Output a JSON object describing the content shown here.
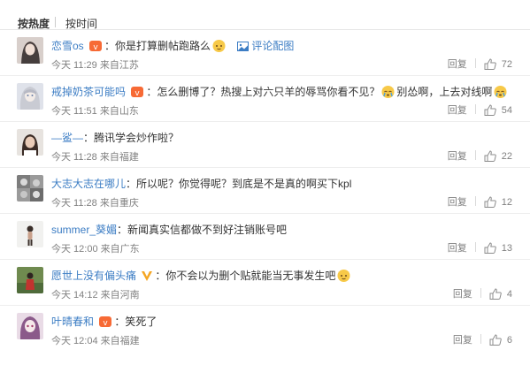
{
  "tabs": {
    "hot": "按热度",
    "time": "按时间"
  },
  "reply_label": "回复",
  "pic_link_label": "评论配图",
  "comments": [
    {
      "user": "恋雪os",
      "text": "你是打算删帖跑路么",
      "time": "今天 11:29 来自江苏",
      "likes": "72"
    },
    {
      "user": "戒掉奶茶可能吗",
      "text": "怎么删博了？热搜上对六只羊的辱骂你看不见？",
      "text2": "别怂啊，上去对线啊",
      "time": "今天 11:51 来自山东",
      "likes": "54"
    },
    {
      "user": "—鲨—",
      "text": "腾讯学会炒作啦？",
      "time": "今天 11:28 来自福建",
      "likes": "22"
    },
    {
      "user": "大志大志在哪儿",
      "text": "所以呢？你觉得呢？到底是不是真的啊买下kpl",
      "time": "今天 11:28 来自重庆",
      "likes": "12"
    },
    {
      "user": "summer_葵媚",
      "text": "新闻真实信都做不到好注销账号吧",
      "time": "今天 12:00 来自广东",
      "likes": "13"
    },
    {
      "user": "愿世上没有偏头痛",
      "text": "你不会以为删个贴就能当无事发生吧",
      "time": "今天 14:12 来自河南",
      "likes": "4"
    },
    {
      "user": "叶晴春和",
      "text": "笑死了",
      "time": "今天 12:04 来自福建",
      "likes": "6"
    }
  ]
}
